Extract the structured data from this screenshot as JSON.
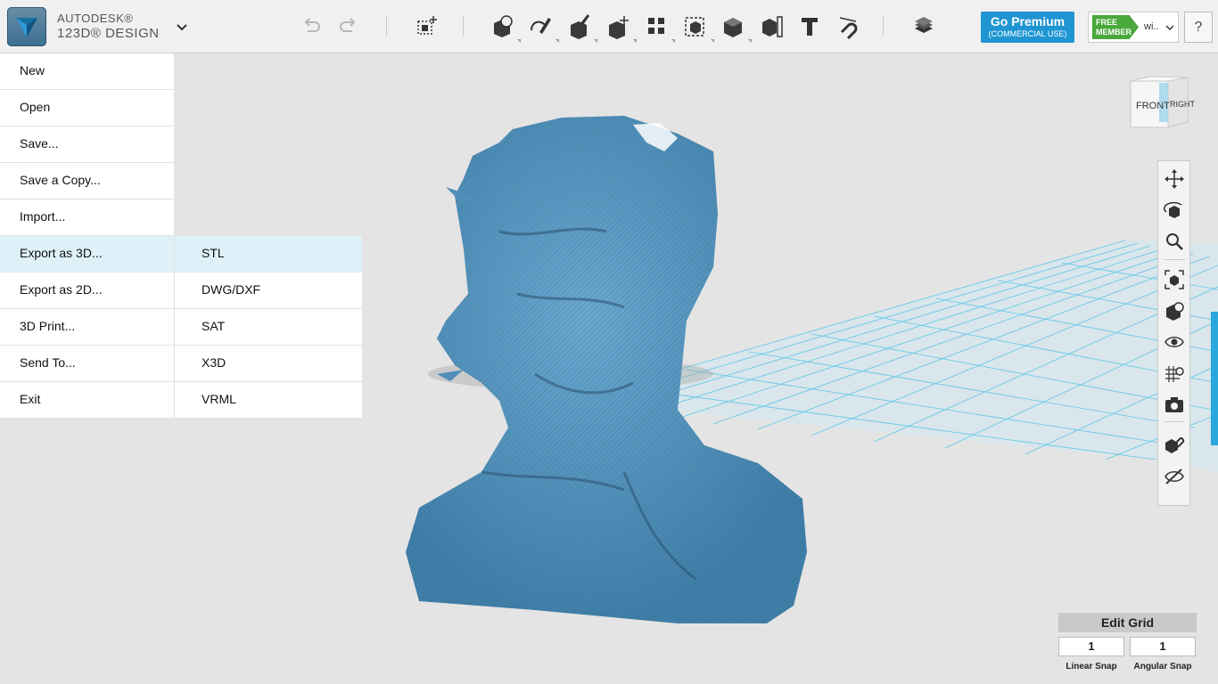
{
  "app": {
    "brand_top": "AUTODESK®",
    "brand_bottom": "123D® DESIGN"
  },
  "toolbar": {
    "tools": [
      "primitives-icon",
      "sketch-icon",
      "construct-icon",
      "modify-icon",
      "pattern-icon",
      "group-icon",
      "combine-icon",
      "measure-icon",
      "text-icon",
      "snap-icon",
      "materials-icon"
    ]
  },
  "account": {
    "premium_label": "Go Premium",
    "premium_sub": "(COMMERCIAL USE)",
    "badge_line1": "FREE",
    "badge_line2": "MEMBER",
    "username": "wi..",
    "help_label": "?"
  },
  "menu": {
    "items": [
      {
        "label": "New"
      },
      {
        "label": "Open"
      },
      {
        "label": "Save..."
      },
      {
        "label": "Save a Copy..."
      },
      {
        "label": "Import..."
      },
      {
        "label": "Export as 3D..."
      },
      {
        "label": "Export as 2D..."
      },
      {
        "label": "3D Print..."
      },
      {
        "label": "Send To..."
      },
      {
        "label": "Exit"
      }
    ],
    "submenu": [
      "STL",
      "DWG/DXF",
      "SAT",
      "X3D",
      "VRML"
    ]
  },
  "navcube": {
    "front": "FRONT",
    "right": "RIGHT"
  },
  "edit_grid": {
    "title": "Edit Grid",
    "linear_value": "1",
    "angular_value": "1",
    "linear_label": "Linear Snap",
    "angular_label": "Angular Snap"
  },
  "colors": {
    "accent": "#1f95d2",
    "model": "#4f8fb8",
    "grid": "#5fc6e8",
    "member_green": "#4aa83c"
  }
}
